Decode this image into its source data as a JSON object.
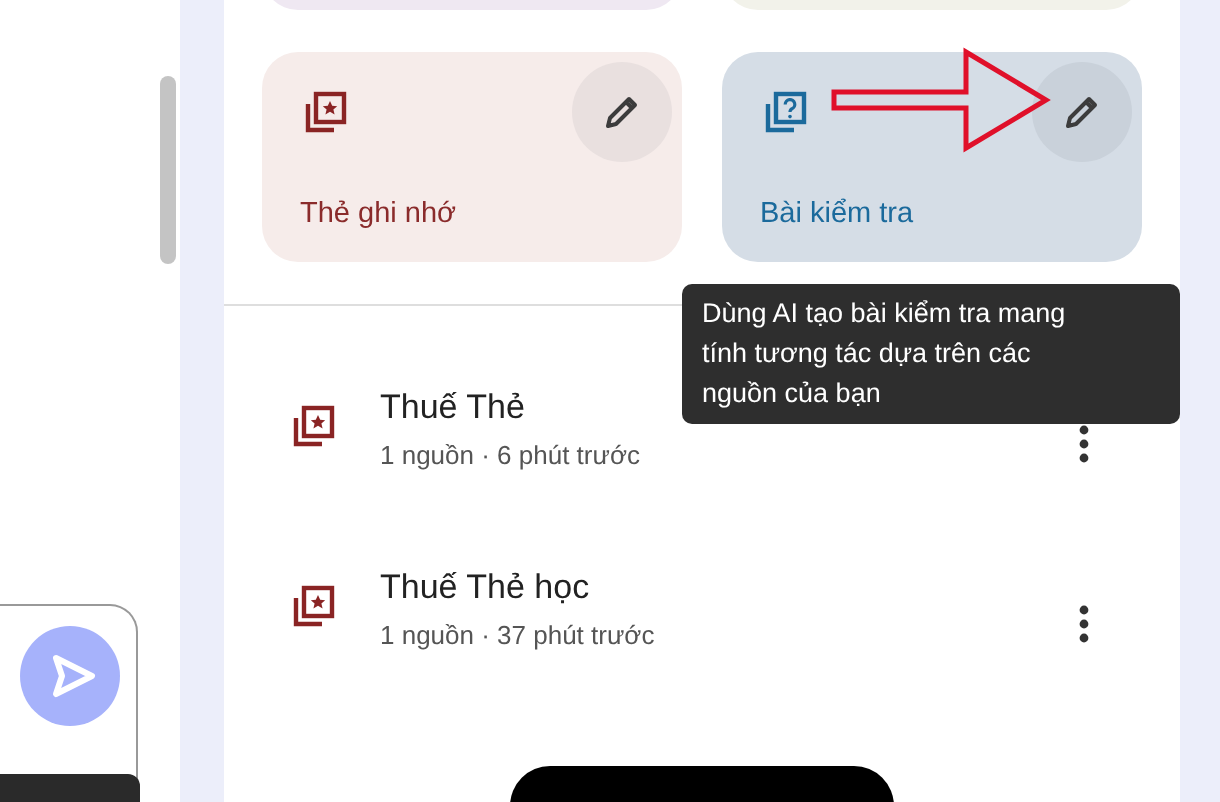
{
  "tools": [
    {
      "kind": "flashcards",
      "label": "Thẻ ghi nhớ"
    },
    {
      "kind": "quiz",
      "label": "Bài kiểm tra"
    }
  ],
  "tooltip": "Dùng AI tạo bài kiểm tra mang tính tương tác dựa trên các nguồn của bạn",
  "notes": [
    {
      "title": "Thuế Thẻ",
      "meta": "1 nguồn · 6 phút trước"
    },
    {
      "title": "Thuế Thẻ học",
      "meta": "1 nguồn · 37 phút trước"
    }
  ]
}
